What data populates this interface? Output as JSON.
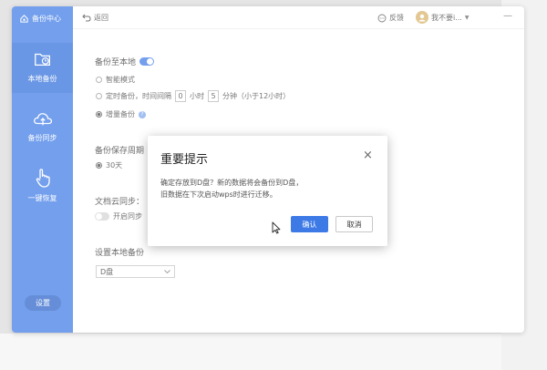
{
  "sidebar": {
    "header": "备份中心",
    "items": [
      {
        "label": "本地备份",
        "icon": "clock-folder-icon"
      },
      {
        "label": "备份同步",
        "icon": "cloud-upload-icon"
      },
      {
        "label": "一键恢复",
        "icon": "hand-pointer-icon"
      }
    ],
    "settings": "设置"
  },
  "topbar": {
    "back": "返回",
    "feedback": "反馈",
    "user": "我不要i...",
    "minimize": "—"
  },
  "backup": {
    "title": "备份至本地",
    "toggle_on": true,
    "options": {
      "smart": "智能模式",
      "timed_prefix": "定时备份，时间间隔",
      "hours_value": "0",
      "hours_unit": "小时",
      "minutes_value": "5",
      "minutes_unit": "分钟（小于12小时）",
      "incremental": "增量备份"
    },
    "retention_title": "备份保存周期",
    "retention_value": "30天",
    "cloud_title": "文档云同步：",
    "cloud_toggle": "开启同步",
    "location_title": "设置本地备份",
    "location_value": "D盘"
  },
  "dialog": {
    "title": "重要提示",
    "close": "×",
    "line1": "确定存放到D盘？新的数据将会备份到D盘，",
    "line2": "旧数据在下次启动wps时进行迁移。",
    "confirm": "确认",
    "cancel": "取消"
  },
  "colors": {
    "accent": "#3d7ae6"
  }
}
